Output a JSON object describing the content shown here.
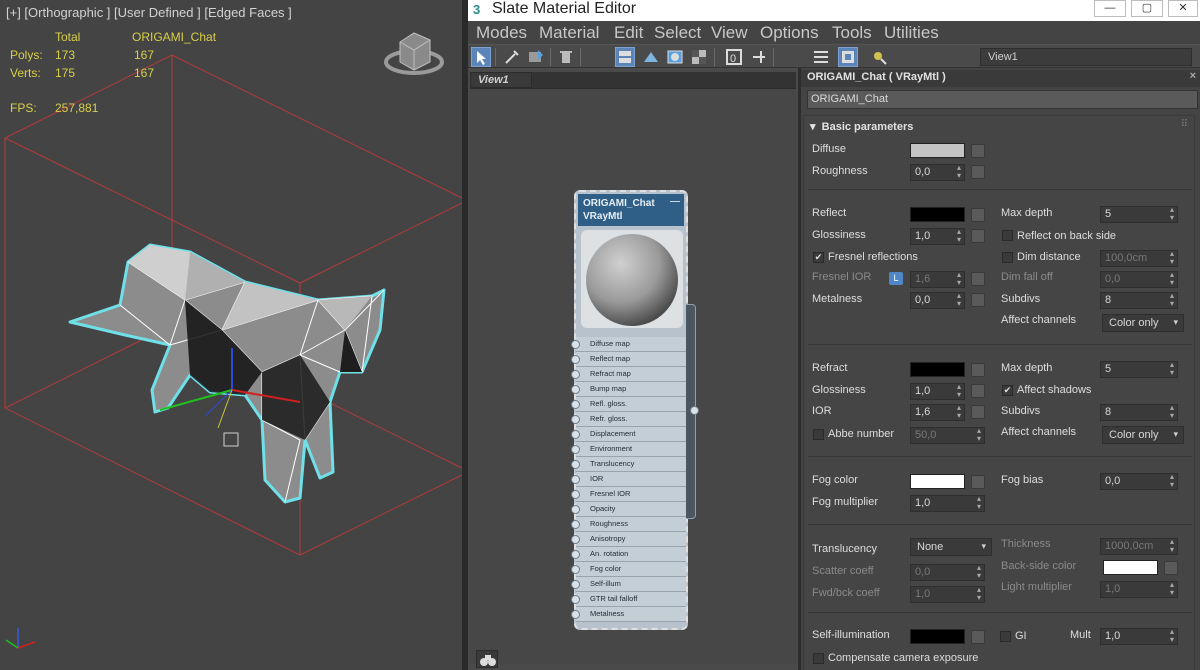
{
  "viewport": {
    "label": "[+] [Orthographic ] [User Defined ] [Edged Faces ]",
    "stats": {
      "col_total": "Total",
      "col_object": "ORIGAMI_Chat",
      "polys_label": "Polys:",
      "polys_total": "173",
      "polys_object": "167",
      "verts_label": "Verts:",
      "verts_total": "175",
      "verts_object": "167",
      "fps_label": "FPS:",
      "fps_value": "257,881"
    }
  },
  "editor": {
    "title": "Slate Material Editor",
    "window_buttons": {
      "minimize": "—",
      "restore": "▢",
      "close": "✕"
    },
    "menu": [
      "Modes",
      "Material",
      "Edit",
      "Select",
      "View",
      "Options",
      "Tools",
      "Utilities"
    ],
    "view_select": "View1",
    "view_tab": "View1"
  },
  "node": {
    "name": "ORIGAMI_Chat",
    "type": "VRayMtl",
    "minimize": "—",
    "slots": [
      "Diffuse map",
      "Reflect map",
      "Refract map",
      "Bump map",
      "Refl. gloss.",
      "Refr. gloss.",
      "Displacement",
      "Environment",
      "Translucency",
      "IOR",
      "Fresnel IOR",
      "Opacity",
      "Roughness",
      "Anisotropy",
      "An. rotation",
      "Fog color",
      "Self-illum",
      "GTR tail falloff",
      "Metalness"
    ]
  },
  "params": {
    "title": "ORIGAMI_Chat  ( VRayMtl )",
    "close": "×",
    "name_field": "ORIGAMI_Chat",
    "rollout_title": "Basic parameters",
    "diffuse": {
      "label": "Diffuse",
      "color": "#c4c4c4"
    },
    "roughness": {
      "label": "Roughness",
      "value": "0,0"
    },
    "reflect": {
      "label": "Reflect",
      "color": "#000000"
    },
    "refl_glossiness": {
      "label": "Glossiness",
      "value": "1,0"
    },
    "fresnel": {
      "label": "Fresnel reflections",
      "checked": "✔"
    },
    "fresnel_ior": {
      "label": "Fresnel IOR",
      "lock": "L",
      "value": "1,6"
    },
    "metalness": {
      "label": "Metalness",
      "value": "0,0"
    },
    "refl_max_depth": {
      "label": "Max depth",
      "value": "5"
    },
    "reflect_back": {
      "label": "Reflect on back side"
    },
    "dim_distance": {
      "label": "Dim distance",
      "value": "100,0cm"
    },
    "dim_falloff": {
      "label": "Dim fall off",
      "value": "0,0"
    },
    "refl_subdivs": {
      "label": "Subdivs",
      "value": "8"
    },
    "refl_affect_channels": {
      "label": "Affect channels",
      "value": "Color only"
    },
    "refract": {
      "label": "Refract",
      "color": "#000000"
    },
    "refr_glossiness": {
      "label": "Glossiness",
      "value": "1,0"
    },
    "ior": {
      "label": "IOR",
      "value": "1,6"
    },
    "abbe": {
      "label": "Abbe number",
      "value": "50,0"
    },
    "refr_max_depth": {
      "label": "Max depth",
      "value": "5"
    },
    "affect_shadows": {
      "label": "Affect shadows",
      "checked": "✔"
    },
    "refr_subdivs": {
      "label": "Subdivs",
      "value": "8"
    },
    "refr_affect_channels": {
      "label": "Affect channels",
      "value": "Color only"
    },
    "fog_color": {
      "label": "Fog color",
      "color": "#ffffff"
    },
    "fog_multiplier": {
      "label": "Fog multiplier",
      "value": "1,0"
    },
    "fog_bias": {
      "label": "Fog bias",
      "value": "0,0"
    },
    "translucency": {
      "label": "Translucency",
      "value": "None"
    },
    "scatter_coeff": {
      "label": "Scatter coeff",
      "value": "0,0"
    },
    "fwd_bck_coeff": {
      "label": "Fwd/bck coeff",
      "value": "1,0"
    },
    "thickness": {
      "label": "Thickness",
      "value": "1000,0cm"
    },
    "backside_color": {
      "label": "Back-side color",
      "color": "#ffffff"
    },
    "light_multiplier": {
      "label": "Light multiplier",
      "value": "1,0"
    },
    "self_illum": {
      "label": "Self-illumination",
      "color": "#000000"
    },
    "gi": {
      "label": "GI"
    },
    "mult": {
      "label": "Mult",
      "value": "1,0"
    },
    "compensate": {
      "label": "Compensate camera exposure"
    }
  },
  "colors": {
    "stat_yellow": "#d8cf48",
    "selection_outline": "#6fe0e8",
    "bbox_red": "#b33a3a",
    "node_header": "#2f5f86",
    "toolbar_active": "#5b84b8"
  }
}
